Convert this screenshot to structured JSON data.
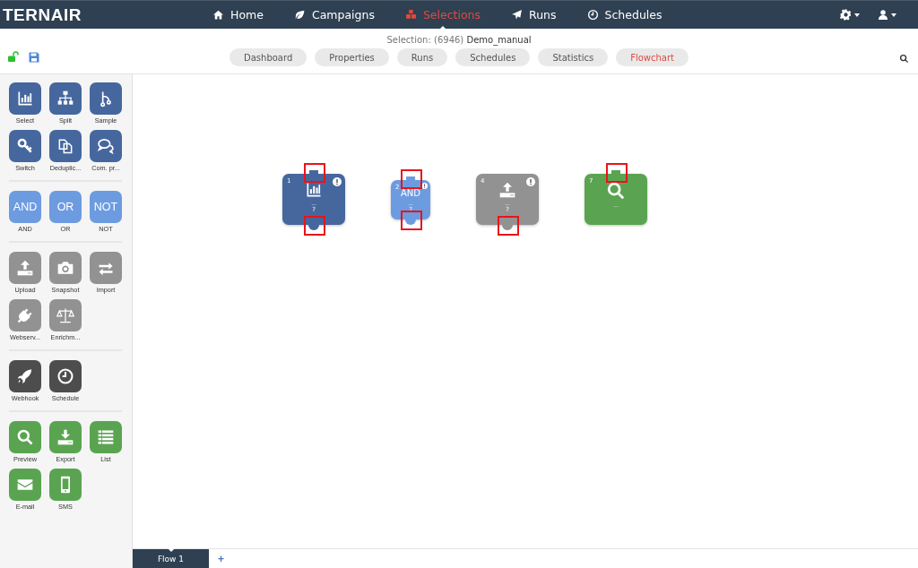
{
  "navbar": {
    "logo": "TERNAIR",
    "items": [
      {
        "kind": "home",
        "label": "Home",
        "selected": false
      },
      {
        "kind": "leaf",
        "label": "Campaigns",
        "selected": false
      },
      {
        "kind": "cubes",
        "label": "Selections",
        "selected": true
      },
      {
        "kind": "plane",
        "label": "Runs",
        "selected": false
      },
      {
        "kind": "clock",
        "label": "Schedules",
        "selected": false
      }
    ]
  },
  "header": {
    "title_prefix": "Selection: (6946)",
    "title_name": "Demo_manual",
    "unlocked": true,
    "tabs": [
      {
        "label": "Dashboard",
        "selected": false
      },
      {
        "label": "Properties",
        "selected": false
      },
      {
        "label": "Runs",
        "selected": false
      },
      {
        "label": "Schedules",
        "selected": false
      },
      {
        "label": "Statistics",
        "selected": false
      },
      {
        "label": "Flowchart",
        "selected": true
      }
    ]
  },
  "palette": [
    {
      "color": "#46679e",
      "items": [
        {
          "kind": "bar-chart",
          "label": "Select"
        },
        {
          "kind": "hierarchy",
          "label": "Split"
        },
        {
          "kind": "branch",
          "label": "Sample"
        },
        {
          "kind": "key",
          "label": "Switch"
        },
        {
          "kind": "copy",
          "label": "Deduplic..."
        },
        {
          "kind": "chat",
          "label": "Com. pr..."
        }
      ]
    },
    {
      "color": "#6d9be0",
      "items": [
        {
          "kind": "text",
          "glyph": "AND",
          "label": "AND"
        },
        {
          "kind": "text",
          "glyph": "OR",
          "label": "OR"
        },
        {
          "kind": "text",
          "glyph": "NOT",
          "label": "NOT"
        }
      ]
    },
    {
      "color": "#929292",
      "items": [
        {
          "kind": "upload",
          "label": "Upload"
        },
        {
          "kind": "camera",
          "label": "Snapshot"
        },
        {
          "kind": "arrows",
          "label": "Import"
        },
        {
          "kind": "plug",
          "label": "Webserv..."
        },
        {
          "kind": "scale",
          "label": "Enrichm..."
        }
      ]
    },
    {
      "color": "#4d4d4d",
      "items": [
        {
          "kind": "rocket",
          "label": "Webhook"
        },
        {
          "kind": "clock",
          "label": "Schedule"
        }
      ]
    },
    {
      "color": "#5aa451",
      "items": [
        {
          "kind": "search",
          "label": "Preview"
        },
        {
          "kind": "download",
          "label": "Export"
        },
        {
          "kind": "list",
          "label": "List"
        },
        {
          "kind": "envelope",
          "label": "E-mail"
        },
        {
          "kind": "phone",
          "label": "SMS"
        }
      ]
    }
  ],
  "canvas": {
    "nodes": [
      {
        "number": "1",
        "kind": "bar-chart",
        "color": "#46679e",
        "warning": true,
        "caption": "...",
        "count": "?",
        "input": {
          "highlighted": true
        },
        "output": {
          "highlighted": true
        }
      },
      {
        "number": "2",
        "kind": "text",
        "glyph": "AND",
        "color": "#6d9be0",
        "warning": true,
        "caption": "...",
        "count": "?",
        "input": {
          "highlighted": true
        },
        "output": {
          "highlighted": true
        }
      },
      {
        "number": "4",
        "kind": "upload",
        "color": "#929292",
        "warning": true,
        "caption": "...",
        "count": "?",
        "output": {
          "highlighted": true
        }
      },
      {
        "number": "7",
        "kind": "search",
        "color": "#5aa451",
        "warning": false,
        "caption": "...",
        "input": {
          "highlighted": true
        }
      }
    ]
  },
  "flow_tabs": {
    "tabs": [
      {
        "label": "Flow 1",
        "selected": true
      }
    ],
    "add": "+"
  }
}
